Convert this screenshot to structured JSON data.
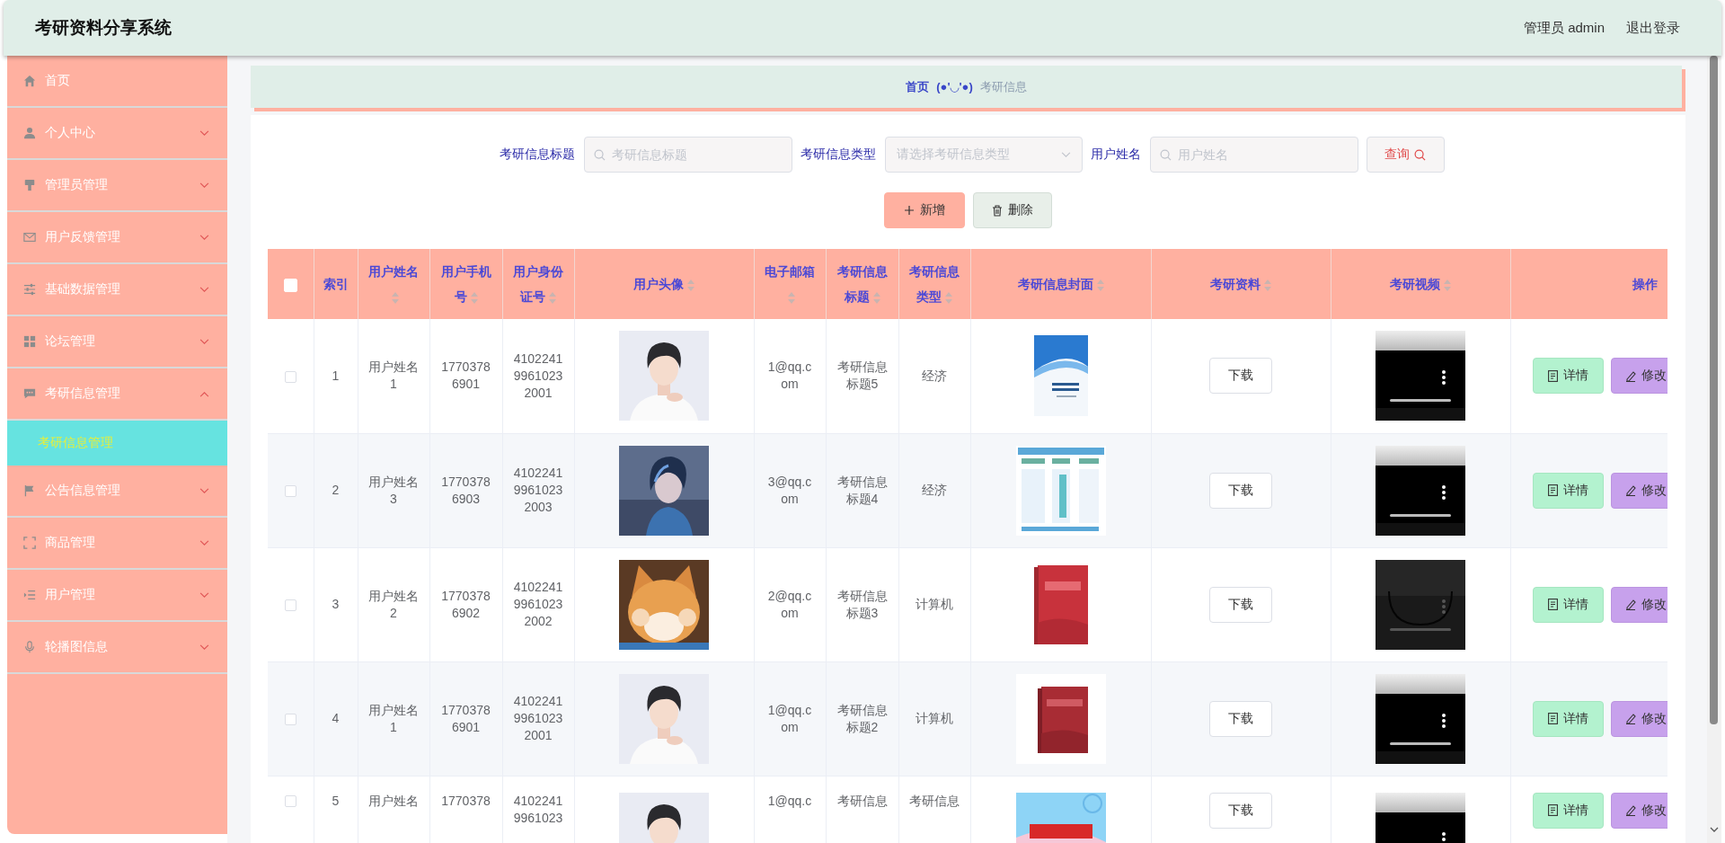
{
  "header": {
    "title": "考研资料分享系统",
    "user": "管理员 admin",
    "logout": "退出登录"
  },
  "sidebar": {
    "items": [
      {
        "label": "首页"
      },
      {
        "label": "个人中心",
        "expanded": false
      },
      {
        "label": "管理员管理",
        "expanded": false
      },
      {
        "label": "用户反馈管理",
        "expanded": false
      },
      {
        "label": "基础数据管理",
        "expanded": false
      },
      {
        "label": "论坛管理",
        "expanded": false
      },
      {
        "label": "考研信息管理",
        "expanded": true,
        "children": [
          {
            "label": "考研信息管理",
            "selected": true
          }
        ]
      },
      {
        "label": "公告信息管理",
        "expanded": false
      },
      {
        "label": "商品管理",
        "expanded": false
      },
      {
        "label": "用户管理",
        "expanded": false
      },
      {
        "label": "轮播图信息",
        "expanded": false
      }
    ]
  },
  "breadcrumb": {
    "home": "首页",
    "separator": "(●'◡'●)",
    "current": "考研信息"
  },
  "search": {
    "fields": [
      {
        "kind": "input",
        "label": "考研信息标题",
        "placeholder": "考研信息标题"
      },
      {
        "kind": "select",
        "label": "考研信息类型",
        "placeholder": "请选择考研信息类型"
      },
      {
        "kind": "input",
        "label": "用户姓名",
        "placeholder": "用户姓名"
      }
    ],
    "button": "查询"
  },
  "toolbar": [
    {
      "kind": "add",
      "label": "新增"
    },
    {
      "kind": "delete",
      "label": "删除"
    }
  ],
  "table": {
    "columns": [
      {
        "kind": "checkbox",
        "checked": false
      },
      {
        "kind": "text",
        "label": "索引",
        "sortable": false
      },
      {
        "kind": "text",
        "label": "用户姓名",
        "sortable": true
      },
      {
        "kind": "text",
        "label": "用户手机号",
        "sortable": true
      },
      {
        "kind": "text",
        "label": "用户身份证号",
        "sortable": true
      },
      {
        "kind": "picture",
        "label": "用户头像",
        "sortable": true
      },
      {
        "kind": "text",
        "label": "电子邮箱",
        "sortable": true
      },
      {
        "kind": "text",
        "label": "考研信息标题",
        "sortable": true
      },
      {
        "kind": "text",
        "label": "考研信息类型",
        "sortable": true
      },
      {
        "kind": "picture",
        "label": "考研信息封面",
        "sortable": true
      },
      {
        "kind": "download",
        "label": "考研资料",
        "sortable": true
      },
      {
        "kind": "picture",
        "label": "考研视频",
        "sortable": true
      },
      {
        "kind": "actions",
        "label": "操作",
        "sortable": false
      }
    ],
    "rows": [
      {
        "cells": [
          {
            "kind": "checkbox",
            "checked": false
          },
          "1",
          "用户姓名1",
          "17703786901",
          "410224199610232001",
          {
            "kind": "picture"
          },
          "1@qq.com",
          "考研信息标题5",
          "经济",
          {
            "kind": "picture"
          },
          "下载",
          {
            "kind": "picture"
          },
          [
            "详情",
            "修改"
          ]
        ]
      },
      {
        "cells": [
          {
            "kind": "checkbox",
            "checked": false
          },
          "2",
          "用户姓名3",
          "17703786903",
          "410224199610232003",
          {
            "kind": "picture"
          },
          "3@qq.com",
          "考研信息标题4",
          "经济",
          {
            "kind": "picture"
          },
          "下载",
          {
            "kind": "picture"
          },
          [
            "详情",
            "修改"
          ]
        ]
      },
      {
        "cells": [
          {
            "kind": "checkbox",
            "checked": false
          },
          "3",
          "用户姓名2",
          "17703786902",
          "410224199610232002",
          {
            "kind": "picture"
          },
          "2@qq.com",
          "考研信息标题3",
          "计算机",
          {
            "kind": "picture"
          },
          "下载",
          {
            "kind": "picture"
          },
          [
            "详情",
            "修改"
          ]
        ]
      },
      {
        "cells": [
          {
            "kind": "checkbox",
            "checked": false
          },
          "4",
          "用户姓名1",
          "17703786901",
          "410224199610232001",
          {
            "kind": "picture"
          },
          "1@qq.com",
          "考研信息标题2",
          "计算机",
          {
            "kind": "picture"
          },
          "下载",
          {
            "kind": "picture"
          },
          [
            "详情",
            "修改"
          ]
        ]
      },
      {
        "cells": [
          {
            "kind": "checkbox",
            "checked": false
          },
          "5",
          "用户姓名",
          "1770378",
          "41022419961023",
          {
            "kind": "picture"
          },
          "1@qq.c",
          "考研信息",
          "考研信息",
          {
            "kind": "picture"
          },
          "下载",
          {
            "kind": "picture"
          },
          [
            "详情",
            "修改"
          ]
        ]
      }
    ]
  }
}
